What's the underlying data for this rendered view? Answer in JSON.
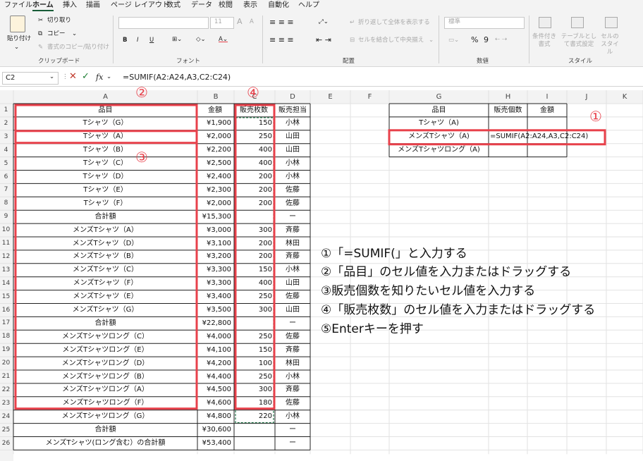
{
  "menu": {
    "tabs": [
      "ファイル",
      "ホーム",
      "挿入",
      "描画",
      "ページ レイアウト",
      "数式",
      "データ",
      "校閲",
      "表示",
      "自動化",
      "ヘルプ"
    ],
    "active": "ホーム"
  },
  "ribbon": {
    "clipboard": {
      "paste": "貼り付け",
      "cut": "切り取り",
      "copy": "コピー",
      "format_painter": "書式のコピー/貼り付け",
      "label": "クリップボード"
    },
    "font": {
      "size": "11",
      "label": "フォント",
      "bold": "B",
      "italic": "I",
      "underline": "U",
      "grow": "A",
      "shrink": "A"
    },
    "alignment": {
      "wrap": "折り返して全体を表示する",
      "merge": "セルを結合して中央揃え",
      "label": "配置"
    },
    "number": {
      "format": "標準",
      "percent": "%",
      "comma": "9",
      "label": "数値"
    },
    "styles": {
      "conditional": "条件付き書式",
      "table": "テーブルとして書式設定",
      "cell": "セルのスタイル",
      "label": "スタイル"
    }
  },
  "formula_bar": {
    "name_box": "C2",
    "fx": "fx",
    "formula": "=SUMIF(A2:A24,A3,C2:C24)"
  },
  "columns": [
    "A",
    "B",
    "C",
    "D",
    "E",
    "F",
    "G",
    "H",
    "I",
    "J",
    "K"
  ],
  "rows": [
    {
      "n": "1",
      "a": "品目",
      "b": "金額",
      "c": "販売枚数",
      "d": "販売担当"
    },
    {
      "n": "2",
      "a": "Tシャツ（G）",
      "b": "¥1,900",
      "c": "150",
      "d": "小林"
    },
    {
      "n": "3",
      "a": "Tシャツ（A）",
      "b": "¥2,000",
      "c": "250",
      "d": "山田"
    },
    {
      "n": "4",
      "a": "Tシャツ（B）",
      "b": "¥2,200",
      "c": "400",
      "d": "山田"
    },
    {
      "n": "5",
      "a": "Tシャツ（C）",
      "b": "¥2,500",
      "c": "400",
      "d": "小林"
    },
    {
      "n": "6",
      "a": "Tシャツ（D）",
      "b": "¥2,400",
      "c": "200",
      "d": "小林"
    },
    {
      "n": "7",
      "a": "Tシャツ（E）",
      "b": "¥2,300",
      "c": "200",
      "d": "佐藤"
    },
    {
      "n": "8",
      "a": "Tシャツ（F）",
      "b": "¥2,000",
      "c": "200",
      "d": "佐藤"
    },
    {
      "n": "9",
      "a": "合計額",
      "b": "¥15,300",
      "c": "",
      "d": "ー"
    },
    {
      "n": "10",
      "a": "メンズTシャツ（A）",
      "b": "¥3,000",
      "c": "300",
      "d": "斉藤"
    },
    {
      "n": "11",
      "a": "メンズTシャツ（D）",
      "b": "¥3,100",
      "c": "200",
      "d": "林田"
    },
    {
      "n": "12",
      "a": "メンズTシャツ（B）",
      "b": "¥3,200",
      "c": "200",
      "d": "斉藤"
    },
    {
      "n": "13",
      "a": "メンズTシャツ（C）",
      "b": "¥3,300",
      "c": "150",
      "d": "小林"
    },
    {
      "n": "14",
      "a": "メンズTシャツ（F）",
      "b": "¥3,300",
      "c": "400",
      "d": "山田"
    },
    {
      "n": "15",
      "a": "メンズTシャツ（E）",
      "b": "¥3,400",
      "c": "250",
      "d": "佐藤"
    },
    {
      "n": "16",
      "a": "メンズTシャツ（G）",
      "b": "¥3,500",
      "c": "300",
      "d": "山田"
    },
    {
      "n": "17",
      "a": "合計額",
      "b": "¥22,800",
      "c": "",
      "d": "ー"
    },
    {
      "n": "18",
      "a": "メンズTシャツロング（C）",
      "b": "¥4,000",
      "c": "250",
      "d": "佐藤"
    },
    {
      "n": "19",
      "a": "メンズTシャツロング（E）",
      "b": "¥4,100",
      "c": "150",
      "d": "斉藤"
    },
    {
      "n": "20",
      "a": "メンズTシャツロング（D）",
      "b": "¥4,200",
      "c": "100",
      "d": "林田"
    },
    {
      "n": "21",
      "a": "メンズTシャツロング（B）",
      "b": "¥4,400",
      "c": "250",
      "d": "小林"
    },
    {
      "n": "22",
      "a": "メンズTシャツロング（A）",
      "b": "¥4,500",
      "c": "300",
      "d": "斉藤"
    },
    {
      "n": "23",
      "a": "メンズTシャツロング（F）",
      "b": "¥4,600",
      "c": "180",
      "d": "佐藤"
    },
    {
      "n": "24",
      "a": "メンズTシャツロング（G）",
      "b": "¥4,800",
      "c": "220",
      "d": "小林"
    },
    {
      "n": "25",
      "a": "合計額",
      "b": "¥30,600",
      "c": "",
      "d": "ー"
    },
    {
      "n": "26",
      "a": "メンズTシャツ(ロング含む）の合計額",
      "b": "¥53,400",
      "c": "",
      "d": "ー"
    }
  ],
  "side_table": {
    "headers": [
      "品目",
      "販売個数",
      "金額"
    ],
    "rows": [
      {
        "g": "Tシャツ（A)",
        "h": "=SUMIF(A2:A24,A3,C2:C24)"
      },
      {
        "g": "メンズTシャツ（A)",
        "h": ""
      },
      {
        "g": "メンズTシャツロング（A)",
        "h": ""
      }
    ]
  },
  "markers": {
    "m1": "①",
    "m2": "②",
    "m3": "③",
    "m4": "④"
  },
  "instructions": [
    "①「=SUMIF(」と入力する",
    "②「品目」のセル値を入力またはドラッグする",
    "③販売個数を知りたいセル値を入力する",
    "④「販売枚数」のセル値を入力またはドラッグする",
    "⑤Enterキーを押す"
  ],
  "colors": {
    "highlight": "#e8414b",
    "menu_bg": "#f3f3f3",
    "grid": "#e2e2e2",
    "active_tab": "#185c37",
    "dashed": "#217346"
  }
}
